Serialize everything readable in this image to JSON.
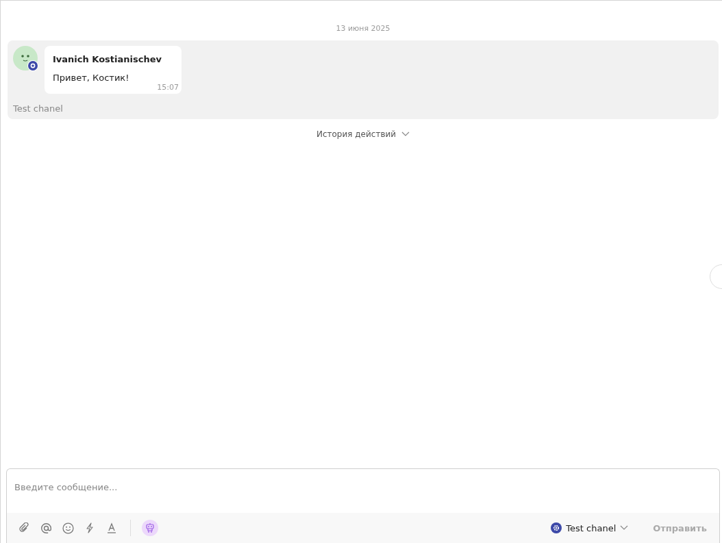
{
  "date_divider": "13 июня 2025",
  "messages": [
    {
      "author": "Ivanich Kostianischev",
      "text": "Привет, Костик!",
      "time": "15:07",
      "channel": "Test chanel"
    }
  ],
  "history_toggle": {
    "label": "История действий",
    "expanded": false
  },
  "composer": {
    "placeholder": "Введите сообщение...",
    "channel": "Test chanel",
    "send_label": "Отправить",
    "send_disabled": true
  }
}
